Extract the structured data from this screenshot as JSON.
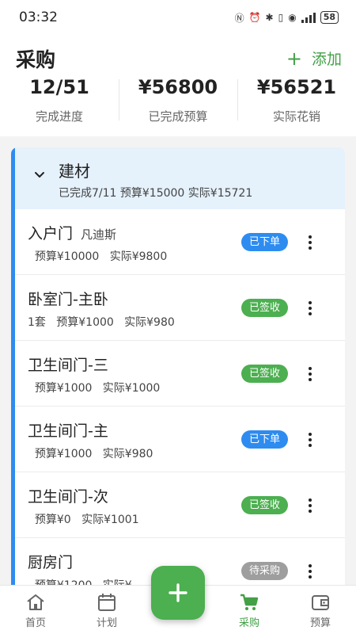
{
  "status_bar": {
    "time": "03:32",
    "battery": "58"
  },
  "header": {
    "title": "采购",
    "add_label": "添加"
  },
  "stats": [
    {
      "value": "12/51",
      "label": "完成进度"
    },
    {
      "value": "¥56800",
      "label": "已完成预算"
    },
    {
      "value": "¥56521",
      "label": "实际花销"
    }
  ],
  "group": {
    "name": "建材",
    "summary": "已完成7/11  预算¥15000  实际¥15721"
  },
  "items": [
    {
      "name": "入户门",
      "brand": "凡迪斯",
      "sub": "  预算¥10000   实际¥9800",
      "status": "已下单"
    },
    {
      "name": "卧室门-主卧",
      "brand": "",
      "sub": "1套   预算¥1000   实际¥980",
      "status": "已签收"
    },
    {
      "name": "卫生间门-三",
      "brand": "",
      "sub": "  预算¥1000   实际¥1000",
      "status": "已签收"
    },
    {
      "name": "卫生间门-主",
      "brand": "",
      "sub": "  预算¥1000   实际¥980",
      "status": "已下单"
    },
    {
      "name": "卫生间门-次",
      "brand": "",
      "sub": "  预算¥0   实际¥1001",
      "status": "已签收"
    },
    {
      "name": "厨房门",
      "brand": "",
      "sub": "  预算¥1200   实际¥",
      "status": "待采购"
    }
  ],
  "status_colors": {
    "已下单": "#2e8cf0",
    "已签收": "#4caf50",
    "待采购": "#9e9e9e"
  },
  "tabs": [
    {
      "label": "首页",
      "icon": "home-icon"
    },
    {
      "label": "计划",
      "icon": "calendar-icon"
    },
    {
      "label": "采购",
      "icon": "cart-icon",
      "active": true
    },
    {
      "label": "预算",
      "icon": "wallet-icon"
    }
  ],
  "fab": {
    "icon": "plus-icon"
  }
}
